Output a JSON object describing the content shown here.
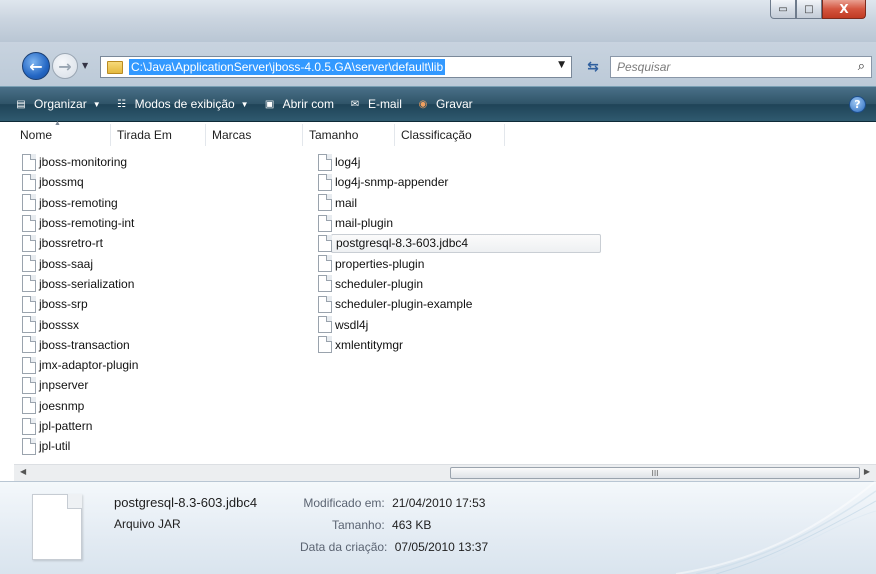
{
  "window": {
    "controls": {
      "minimize": "▭",
      "maximize": "□",
      "close": "X"
    }
  },
  "nav": {
    "address": "C:\\Java\\ApplicationServer\\jboss-4.0.5.GA\\server\\default\\lib",
    "search_placeholder": "Pesquisar"
  },
  "toolbar": {
    "organize": "Organizar",
    "views": "Modos de exibição",
    "open_with": "Abrir com",
    "email": "E-mail",
    "burn": "Gravar",
    "help": "?"
  },
  "columns": [
    "Nome",
    "Tirada Em",
    "Marcas",
    "Tamanho",
    "Classificação"
  ],
  "files_left": [
    "jboss-monitoring",
    "jbossmq",
    "jboss-remoting",
    "jboss-remoting-int",
    "jbossretro-rt",
    "jboss-saaj",
    "jboss-serialization",
    "jboss-srp",
    "jbosssx",
    "jboss-transaction",
    "jmx-adaptor-plugin",
    "jnpserver",
    "joesnmp",
    "jpl-pattern",
    "jpl-util"
  ],
  "files_right": [
    "log4j",
    "log4j-snmp-appender",
    "mail",
    "mail-plugin",
    "postgresql-8.3-603.jdbc4",
    "properties-plugin",
    "scheduler-plugin",
    "scheduler-plugin-example",
    "wsdl4j",
    "xmlentitymgr"
  ],
  "selected_file": "postgresql-8.3-603.jdbc4",
  "scrollbar": {
    "grip": "III"
  },
  "details": {
    "name": "postgresql-8.3-603.jdbc4",
    "type": "Arquivo JAR",
    "modified_label": "Modificado em:",
    "modified_value": "21/04/2010 17:53",
    "size_label": "Tamanho:",
    "size_value": "463 KB",
    "created_label": "Data da criação:",
    "created_value": "07/05/2010 13:37"
  }
}
